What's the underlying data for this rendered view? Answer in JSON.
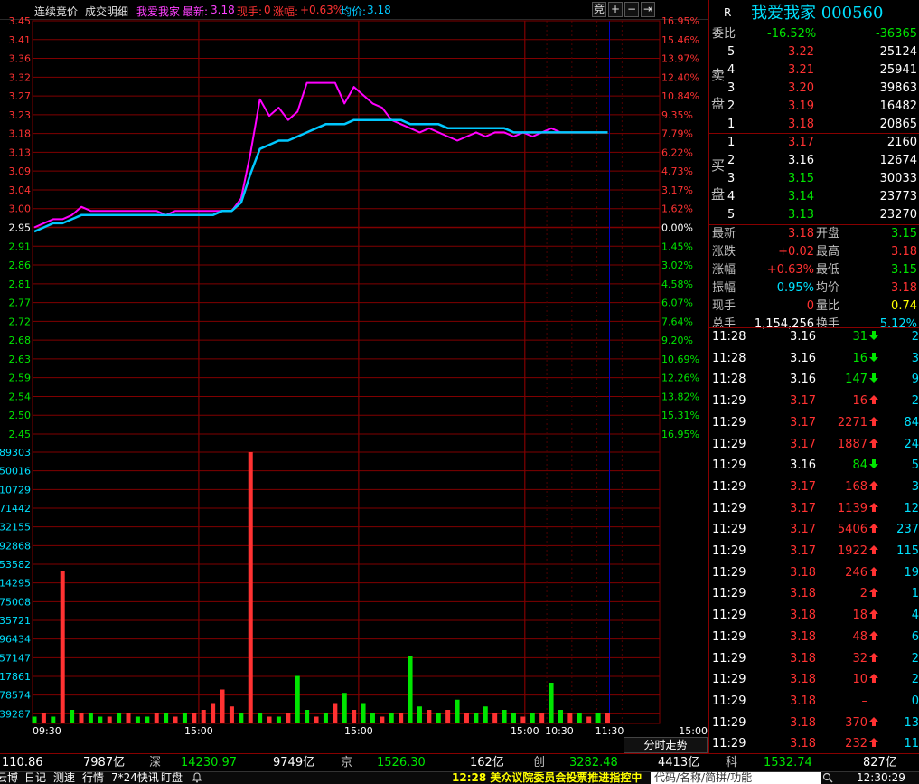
{
  "toolbar": {
    "tabs": [
      "连续竞价",
      "成交明细"
    ],
    "stock_name": "我爱我家",
    "latest_label": "最新:",
    "latest_value": "3.18",
    "volume_label": "现手:",
    "volume_value": "0",
    "change_label": "涨幅:",
    "change_value": "+0.63%",
    "avg_label": "均价:",
    "avg_value": "3.18",
    "btn_auction": "竞",
    "btn_plus": "+",
    "btn_minus": "−",
    "btn_next": "⇥"
  },
  "chart_data": {
    "type": "line",
    "prev_close": 2.95,
    "price_ticks_left": [
      "3.45",
      "3.41",
      "3.36",
      "3.32",
      "3.27",
      "3.23",
      "3.18",
      "3.13",
      "3.09",
      "3.04",
      "3.00",
      "2.95",
      "2.91",
      "2.86",
      "2.81",
      "2.77",
      "2.72",
      "2.68",
      "2.63",
      "2.59",
      "2.54",
      "2.50",
      "2.45"
    ],
    "pct_ticks_right": [
      "16.95%",
      "15.46%",
      "13.97%",
      "12.40%",
      "10.84%",
      "9.35%",
      "7.79%",
      "6.22%",
      "4.73%",
      "3.17%",
      "1.62%",
      "0.00%",
      "1.45%",
      "3.02%",
      "4.58%",
      "6.07%",
      "7.64%",
      "9.20%",
      "10.69%",
      "12.26%",
      "13.82%",
      "15.31%",
      "16.95%"
    ],
    "volume_ticks_left": [
      "89303",
      "50016",
      "10729",
      "71442",
      "32155",
      "92868",
      "53582",
      "14295",
      "75008",
      "35721",
      "96434",
      "57147",
      "17861",
      "78574",
      "39287"
    ],
    "time_labels": [
      "09:30",
      "15:00",
      "15:00",
      "15:00",
      "10:30",
      "11:30",
      "15:00"
    ],
    "series": [
      {
        "color": "#ff00ff",
        "values": [
          2.95,
          2.96,
          2.97,
          2.97,
          2.98,
          3.0,
          2.99,
          2.99,
          2.99,
          2.99,
          2.99,
          2.99,
          2.99,
          2.99,
          2.98,
          2.99,
          2.99,
          2.99,
          2.99,
          2.99,
          2.99,
          2.99,
          3.02,
          3.13,
          3.26,
          3.22,
          3.24,
          3.21,
          3.23,
          3.3,
          3.3,
          3.3,
          3.3,
          3.25,
          3.29,
          3.27,
          3.25,
          3.24,
          3.21,
          3.2,
          3.19,
          3.18,
          3.19,
          3.18,
          3.17,
          3.16,
          3.17,
          3.18,
          3.17,
          3.18,
          3.18,
          3.17,
          3.18,
          3.17,
          3.18,
          3.19,
          3.18,
          3.18,
          3.18,
          3.18,
          3.18,
          3.18
        ]
      },
      {
        "color": "#00c8ff",
        "values": [
          2.94,
          2.95,
          2.96,
          2.96,
          2.97,
          2.98,
          2.98,
          2.98,
          2.98,
          2.98,
          2.98,
          2.98,
          2.98,
          2.98,
          2.98,
          2.98,
          2.98,
          2.98,
          2.98,
          2.98,
          2.99,
          2.99,
          3.01,
          3.08,
          3.14,
          3.15,
          3.16,
          3.16,
          3.17,
          3.18,
          3.19,
          3.2,
          3.2,
          3.2,
          3.21,
          3.21,
          3.21,
          3.21,
          3.21,
          3.21,
          3.2,
          3.2,
          3.2,
          3.2,
          3.19,
          3.19,
          3.19,
          3.19,
          3.19,
          3.19,
          3.19,
          3.18,
          3.18,
          3.18,
          3.18,
          3.18,
          3.18,
          3.18,
          3.18,
          3.18,
          3.18,
          3.18
        ]
      }
    ],
    "volume_values": [
      2,
      3,
      2,
      45,
      4,
      3,
      3,
      2,
      2,
      3,
      3,
      2,
      2,
      3,
      3,
      2,
      3,
      3,
      4,
      6,
      10,
      5,
      3,
      80,
      3,
      2,
      2,
      3,
      14,
      4,
      2,
      3,
      6,
      9,
      4,
      6,
      3,
      2,
      3,
      3,
      20,
      5,
      4,
      3,
      4,
      7,
      3,
      3,
      5,
      3,
      4,
      3,
      2,
      3,
      3,
      12,
      4,
      3,
      3,
      2,
      3,
      3
    ],
    "volume_colors": [
      "g",
      "r",
      "g",
      "r",
      "g",
      "r",
      "g",
      "g",
      "r",
      "g",
      "r",
      "g",
      "g",
      "r",
      "g",
      "r",
      "g",
      "r",
      "r",
      "r",
      "r",
      "r",
      "g",
      "r",
      "g",
      "r",
      "g",
      "r",
      "g",
      "g",
      "r",
      "g",
      "r",
      "g",
      "r",
      "g",
      "g",
      "r",
      "g",
      "r",
      "g",
      "g",
      "r",
      "g",
      "r",
      "g",
      "r",
      "g",
      "g",
      "r",
      "g",
      "g",
      "r",
      "g",
      "r",
      "g",
      "g",
      "r",
      "g",
      "r",
      "g",
      "r"
    ]
  },
  "rp": {
    "rating": "R",
    "title": "我爱我家 000560",
    "weibi_label": "委比",
    "weibi_pct": "-16.52%",
    "weibi_diff": "-36365",
    "sell_label_1": "卖",
    "sell_label_2": "盘",
    "buy_label_1": "买",
    "buy_label_2": "盘",
    "sell": [
      {
        "n": "5",
        "price": "3.22",
        "vol": "25124"
      },
      {
        "n": "4",
        "price": "3.21",
        "vol": "25941"
      },
      {
        "n": "3",
        "price": "3.20",
        "vol": "39863"
      },
      {
        "n": "2",
        "price": "3.19",
        "vol": "16482"
      },
      {
        "n": "1",
        "price": "3.18",
        "vol": "20865"
      }
    ],
    "buy": [
      {
        "n": "1",
        "price": "3.17",
        "vol": "2160"
      },
      {
        "n": "2",
        "price": "3.16",
        "vol": "12674"
      },
      {
        "n": "3",
        "price": "3.15",
        "vol": "30033"
      },
      {
        "n": "4",
        "price": "3.14",
        "vol": "23773"
      },
      {
        "n": "5",
        "price": "3.13",
        "vol": "23270"
      }
    ],
    "stats": [
      {
        "l1": "最新",
        "v1": "3.18",
        "l2": "开盘",
        "v2": "3.15"
      },
      {
        "l1": "涨跌",
        "v1": "+0.02",
        "l2": "最高",
        "v2": "3.18"
      },
      {
        "l1": "涨幅",
        "v1": "+0.63%",
        "l2": "最低",
        "v2": "3.15"
      },
      {
        "l1": "振幅",
        "v1": "0.95%",
        "l2": "均价",
        "v2": "3.18"
      },
      {
        "l1": "现手",
        "v1": "0",
        "l2": "量比",
        "v2": "0.74"
      },
      {
        "l1": "总手",
        "v1": "1,154,256",
        "l2": "换手",
        "v2": "5.12%"
      }
    ],
    "trades": [
      {
        "t": "11:28",
        "p": "3.16",
        "v": "31",
        "d": "down",
        "c": "2"
      },
      {
        "t": "11:28",
        "p": "3.16",
        "v": "16",
        "d": "down",
        "c": "3"
      },
      {
        "t": "11:28",
        "p": "3.16",
        "v": "147",
        "d": "down",
        "c": "9"
      },
      {
        "t": "11:29",
        "p": "3.17",
        "v": "16",
        "d": "up",
        "c": "2"
      },
      {
        "t": "11:29",
        "p": "3.17",
        "v": "2271",
        "d": "up",
        "c": "84"
      },
      {
        "t": "11:29",
        "p": "3.17",
        "v": "1887",
        "d": "up",
        "c": "24"
      },
      {
        "t": "11:29",
        "p": "3.16",
        "v": "84",
        "d": "down",
        "c": "5"
      },
      {
        "t": "11:29",
        "p": "3.17",
        "v": "168",
        "d": "up",
        "c": "3"
      },
      {
        "t": "11:29",
        "p": "3.17",
        "v": "1139",
        "d": "up",
        "c": "12"
      },
      {
        "t": "11:29",
        "p": "3.17",
        "v": "5406",
        "d": "up",
        "c": "237"
      },
      {
        "t": "11:29",
        "p": "3.17",
        "v": "1922",
        "d": "up",
        "c": "115"
      },
      {
        "t": "11:29",
        "p": "3.18",
        "v": "246",
        "d": "up",
        "c": "19"
      },
      {
        "t": "11:29",
        "p": "3.18",
        "v": "2",
        "d": "up",
        "c": "1"
      },
      {
        "t": "11:29",
        "p": "3.18",
        "v": "18",
        "d": "up",
        "c": "4"
      },
      {
        "t": "11:29",
        "p": "3.18",
        "v": "48",
        "d": "up",
        "c": "6"
      },
      {
        "t": "11:29",
        "p": "3.18",
        "v": "32",
        "d": "up",
        "c": "2"
      },
      {
        "t": "11:29",
        "p": "3.18",
        "v": "10",
        "d": "up",
        "c": "2"
      },
      {
        "t": "11:29",
        "p": "3.18",
        "v": "–",
        "d": "none",
        "c": "0"
      },
      {
        "t": "11:29",
        "p": "3.18",
        "v": "370",
        "d": "up",
        "c": "13"
      },
      {
        "t": "11:29",
        "p": "3.18",
        "v": "232",
        "d": "up",
        "c": "11"
      }
    ]
  },
  "fenshi_label": "分时走势",
  "index_bar": {
    "i1_val": "110.86",
    "i1_amt": "7987亿",
    "i2_name": "深",
    "i2_val": "14230.97",
    "i2_amt": "9749亿",
    "i3_name": "京",
    "i3_val": "1526.30",
    "i3_amt": "162亿",
    "i4_name": "创",
    "i4_val": "3282.48",
    "i4_amt": "4413亿",
    "i5_name": "科",
    "i5_val": "1532.74",
    "i5_amt": "827亿"
  },
  "bottom_bar": {
    "tabs": [
      "云博",
      "日记",
      "测速",
      "行情",
      "7*24快讯",
      "盯盘"
    ],
    "news": "12:28 美众议院委员会投票推进指控中",
    "search": "代码/名称/简拼/功能",
    "clock": "12:30:29"
  }
}
